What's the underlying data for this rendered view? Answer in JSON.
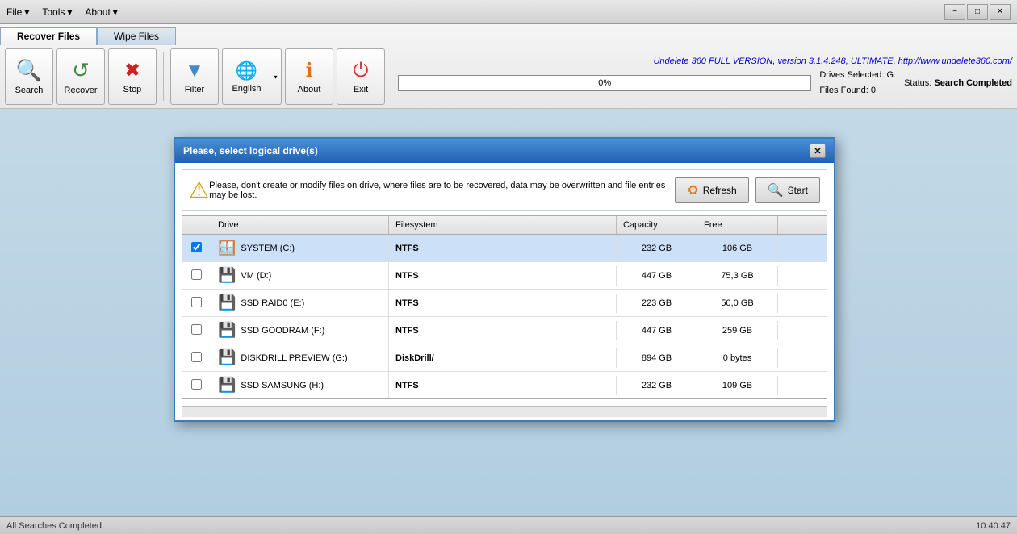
{
  "titlebar": {
    "menus": [
      {
        "label": "File",
        "id": "file"
      },
      {
        "label": "Tools",
        "id": "tools"
      },
      {
        "label": "About",
        "id": "about"
      }
    ],
    "controls": {
      "minimize": "−",
      "restore": "□",
      "close": "✕"
    }
  },
  "tabs": [
    {
      "label": "Recover Files",
      "active": true
    },
    {
      "label": "Wipe Files",
      "active": false
    }
  ],
  "toolbar": {
    "buttons": [
      {
        "label": "Search",
        "icon": "🔍",
        "id": "search"
      },
      {
        "label": "Recover",
        "icon": "🔄",
        "id": "recover"
      },
      {
        "label": "Stop",
        "icon": "✖",
        "id": "stop"
      },
      {
        "label": "Filter",
        "icon": "▼",
        "id": "filter"
      },
      {
        "label": "English",
        "icon": "🌐",
        "id": "english",
        "has_arrow": true
      },
      {
        "label": "About",
        "icon": "ℹ",
        "id": "about"
      },
      {
        "label": "Exit",
        "icon": "⏻",
        "id": "exit"
      }
    ]
  },
  "version_link": {
    "text": "Undelete 360 FULL VERSION, version 3.1.4.248, ULTIMATE, http://www.undelete360.com/",
    "url": "#"
  },
  "status": {
    "progress_percent": "0%",
    "drives_selected": "Drives Selected: G:",
    "files_found": "Files Found: 0",
    "status_label": "Status:",
    "status_value": "Search Completed"
  },
  "dialog": {
    "title": "Please, select logical drive(s)",
    "warning_text": "Please, don't create or modify files on drive, where files are to be recovered, data may be overwritten and file entries may be lost.",
    "refresh_label": "Refresh",
    "start_label": "Start",
    "columns": [
      {
        "label": "",
        "id": "checkbox"
      },
      {
        "label": "Drive",
        "id": "drive"
      },
      {
        "label": "Filesystem",
        "id": "filesystem"
      },
      {
        "label": "Capacity",
        "id": "capacity"
      },
      {
        "label": "Free",
        "id": "free"
      },
      {
        "label": "",
        "id": "extra"
      }
    ],
    "drives": [
      {
        "checked": true,
        "name": "SYSTEM (C:)",
        "filesystem": "NTFS",
        "capacity": "232 GB",
        "free": "106 GB",
        "type": "windows",
        "selected": true
      },
      {
        "checked": false,
        "name": "VM (D:)",
        "filesystem": "NTFS",
        "capacity": "447 GB",
        "free": "75,3 GB",
        "type": "hdd",
        "selected": false
      },
      {
        "checked": false,
        "name": "SSD RAID0 (E:)",
        "filesystem": "NTFS",
        "capacity": "223 GB",
        "free": "50,0 GB",
        "type": "hdd",
        "selected": false
      },
      {
        "checked": false,
        "name": "SSD GOODRAM (F:)",
        "filesystem": "NTFS",
        "capacity": "447 GB",
        "free": "259 GB",
        "type": "hdd",
        "selected": false
      },
      {
        "checked": false,
        "name": "DISKDRILL PREVIEW (G:)",
        "filesystem": "DiskDrill/",
        "capacity": "894 GB",
        "free": "0 bytes",
        "type": "hdd",
        "selected": false
      },
      {
        "checked": false,
        "name": "SSD SAMSUNG (H:)",
        "filesystem": "NTFS",
        "capacity": "232 GB",
        "free": "109 GB",
        "type": "hdd",
        "selected": false
      }
    ]
  },
  "bottom_bar": {
    "left_text": "All Searches Completed",
    "right_text": "10:40:47"
  }
}
